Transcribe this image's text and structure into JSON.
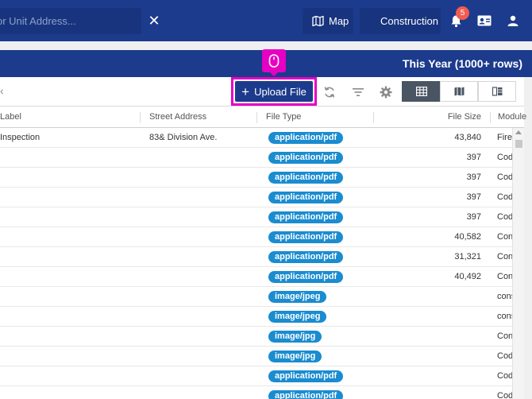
{
  "header": {
    "search_placeholder": "or Unit Address...",
    "map_label": "Map",
    "module_label": "Construction",
    "notification_count": "5"
  },
  "subheader": {
    "title": "This Year (1000+ rows)"
  },
  "toolbar": {
    "upload_label": "Upload File"
  },
  "table": {
    "columns": [
      "Label",
      "Street Address",
      "File Type",
      "File Size",
      "Module"
    ],
    "rows": [
      {
        "label": "Inspection",
        "address": "83& Division Ave.",
        "type": "application/pdf",
        "size": "43,840",
        "module": "Fire"
      },
      {
        "label": "",
        "address": "",
        "type": "application/pdf",
        "size": "397",
        "module": "Cod"
      },
      {
        "label": "",
        "address": "",
        "type": "application/pdf",
        "size": "397",
        "module": "Cod"
      },
      {
        "label": "",
        "address": "",
        "type": "application/pdf",
        "size": "397",
        "module": "Cod"
      },
      {
        "label": "",
        "address": "",
        "type": "application/pdf",
        "size": "397",
        "module": "Cod"
      },
      {
        "label": "",
        "address": "",
        "type": "application/pdf",
        "size": "40,582",
        "module": "Con"
      },
      {
        "label": "",
        "address": "",
        "type": "application/pdf",
        "size": "31,321",
        "module": "Con"
      },
      {
        "label": "",
        "address": "",
        "type": "application/pdf",
        "size": "40,492",
        "module": "Con"
      },
      {
        "label": "",
        "address": "",
        "type": "image/jpeg",
        "size": "",
        "module": "cons"
      },
      {
        "label": "",
        "address": "",
        "type": "image/jpeg",
        "size": "",
        "module": "cons"
      },
      {
        "label": "",
        "address": "",
        "type": "image/jpg",
        "size": "",
        "module": "Con"
      },
      {
        "label": "",
        "address": "",
        "type": "image/jpg",
        "size": "",
        "module": "Cod"
      },
      {
        "label": "",
        "address": "",
        "type": "application/pdf",
        "size": "",
        "module": "Cod"
      },
      {
        "label": "",
        "address": "",
        "type": "application/pdf",
        "size": "",
        "module": "Cod"
      }
    ]
  },
  "colors": {
    "nav_bg": "#1d3b8c",
    "pill": "#1a8cd0",
    "highlight": "#e600c4",
    "badge": "#f25c4f"
  },
  "icons": [
    "map-icon",
    "grid-icon",
    "bell-icon",
    "id-card-icon",
    "person-icon",
    "mouse-icon",
    "refresh-icon",
    "filter-icon",
    "gear-icon",
    "table-view-icon",
    "map-view-icon",
    "split-view-icon"
  ]
}
